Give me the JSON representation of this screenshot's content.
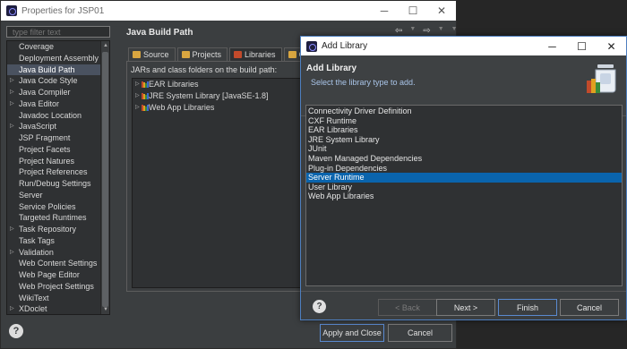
{
  "properties_window": {
    "title": "Properties for JSP01",
    "controls": {
      "minimize": "─",
      "maximize": "☐",
      "close": "✕"
    },
    "filter": {
      "placeholder": "type filter text"
    },
    "tree_items": [
      {
        "label": "Coverage",
        "expandable": false,
        "selected": false
      },
      {
        "label": "Deployment Assembly",
        "expandable": false,
        "selected": false
      },
      {
        "label": "Java Build Path",
        "expandable": false,
        "selected": true
      },
      {
        "label": "Java Code Style",
        "expandable": true,
        "selected": false
      },
      {
        "label": "Java Compiler",
        "expandable": true,
        "selected": false
      },
      {
        "label": "Java Editor",
        "expandable": true,
        "selected": false
      },
      {
        "label": "Javadoc Location",
        "expandable": false,
        "selected": false
      },
      {
        "label": "JavaScript",
        "expandable": true,
        "selected": false
      },
      {
        "label": "JSP Fragment",
        "expandable": false,
        "selected": false
      },
      {
        "label": "Project Facets",
        "expandable": false,
        "selected": false
      },
      {
        "label": "Project Natures",
        "expandable": false,
        "selected": false
      },
      {
        "label": "Project References",
        "expandable": false,
        "selected": false
      },
      {
        "label": "Run/Debug Settings",
        "expandable": false,
        "selected": false
      },
      {
        "label": "Server",
        "expandable": false,
        "selected": false
      },
      {
        "label": "Service Policies",
        "expandable": false,
        "selected": false
      },
      {
        "label": "Targeted Runtimes",
        "expandable": false,
        "selected": false
      },
      {
        "label": "Task Repository",
        "expandable": true,
        "selected": false
      },
      {
        "label": "Task Tags",
        "expandable": false,
        "selected": false
      },
      {
        "label": "Validation",
        "expandable": true,
        "selected": false
      },
      {
        "label": "Web Content Settings",
        "expandable": false,
        "selected": false
      },
      {
        "label": "Web Page Editor",
        "expandable": false,
        "selected": false
      },
      {
        "label": "Web Project Settings",
        "expandable": false,
        "selected": false
      },
      {
        "label": "WikiText",
        "expandable": false,
        "selected": false
      },
      {
        "label": "XDoclet",
        "expandable": true,
        "selected": false
      }
    ],
    "page_title": "Java Build Path",
    "nav": {
      "back": "⇦",
      "back_menu": "▼",
      "forward": "⇨",
      "forward_menu": "▼",
      "view_menu": "▼"
    },
    "tabs": [
      {
        "label": "Source",
        "icon": "source-folder-icon",
        "active": false
      },
      {
        "label": "Projects",
        "icon": "projects-icon",
        "active": false
      },
      {
        "label": "Libraries",
        "icon": "libraries-icon",
        "active": true
      },
      {
        "label": "Orde",
        "icon": "order-export-icon",
        "active": false
      }
    ],
    "jar_caption": "JARs and class folders on the build path:",
    "libraries": [
      "EAR Libraries",
      "JRE System Library [JavaSE-1.8]",
      "Web App Libraries"
    ],
    "buttons": {
      "apply_close": "Apply and Close",
      "cancel": "Cancel"
    },
    "help": "?"
  },
  "dialog": {
    "title": "Add Library",
    "controls": {
      "minimize": "─",
      "maximize": "☐",
      "close": "✕"
    },
    "heading": "Add Library",
    "description": "Select the library type to add.",
    "library_types": [
      {
        "label": "Connectivity Driver Definition",
        "selected": false
      },
      {
        "label": "CXF Runtime",
        "selected": false
      },
      {
        "label": "EAR Libraries",
        "selected": false
      },
      {
        "label": "JRE System Library",
        "selected": false
      },
      {
        "label": "JUnit",
        "selected": false
      },
      {
        "label": "Maven Managed Dependencies",
        "selected": false
      },
      {
        "label": "Plug-in Dependencies",
        "selected": false
      },
      {
        "label": "Server Runtime",
        "selected": true
      },
      {
        "label": "User Library",
        "selected": false
      },
      {
        "label": "Web App Libraries",
        "selected": false
      }
    ],
    "buttons": {
      "back": "< Back",
      "next": "Next >",
      "finish": "Finish",
      "cancel": "Cancel"
    },
    "help": "?"
  },
  "colors": {
    "selection": "#0a64ad",
    "tree_selection": "#4a5260",
    "window_bg": "#3b3e40",
    "accent_border": "#5a8ad0"
  }
}
